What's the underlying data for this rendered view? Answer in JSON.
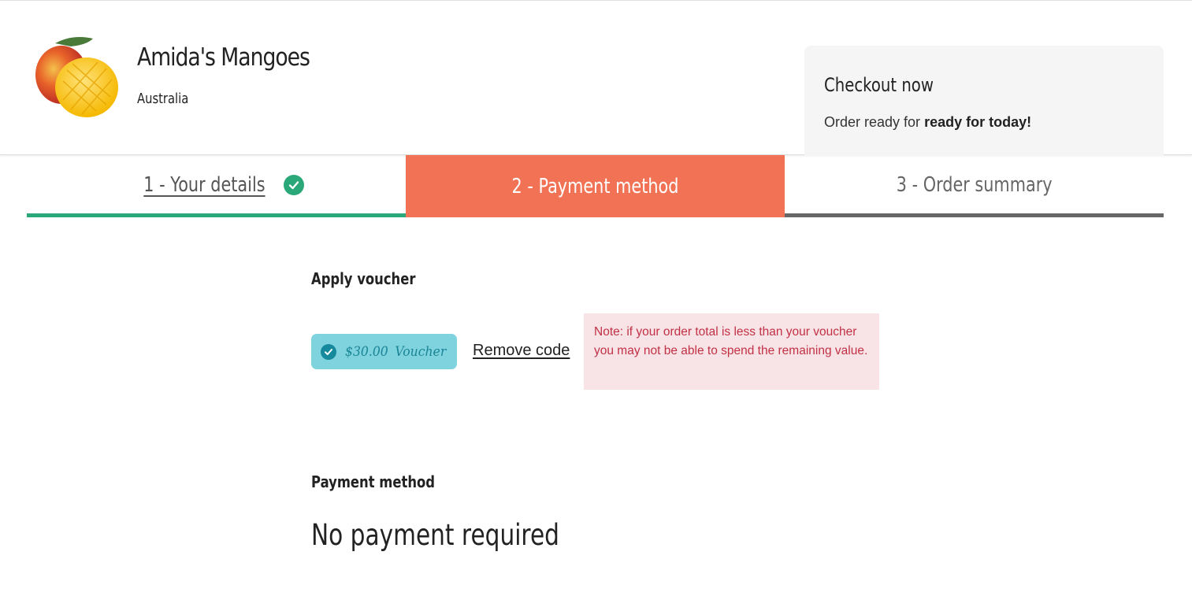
{
  "store": {
    "name": "Amida's Mangoes",
    "country": "Australia",
    "logo_icon": "mango-icon"
  },
  "checkout": {
    "title": "Checkout now",
    "subtitle_prefix": "Order ready for",
    "subtitle_emphasis": "ready for today!"
  },
  "steps": [
    {
      "label": "1 - Your details",
      "state": "completed",
      "icon": "check-circle-icon"
    },
    {
      "label": "2 - Payment method",
      "state": "active"
    },
    {
      "label": "3 - Order summary",
      "state": "upcoming"
    }
  ],
  "voucher": {
    "heading": "Apply voucher",
    "amount": "$30.00",
    "type": "Voucher",
    "remove_label": "Remove code",
    "note": "Note: if your order total is less than your voucher you may not be able to spend the remaining value."
  },
  "payment": {
    "heading": "Payment method",
    "status": "No payment required"
  },
  "colors": {
    "accent_active": "#f17254",
    "complete_green": "#2aa87a",
    "voucher_chip": "#7fd3de",
    "note_bg": "#f8e4e6",
    "note_text": "#c23045"
  }
}
